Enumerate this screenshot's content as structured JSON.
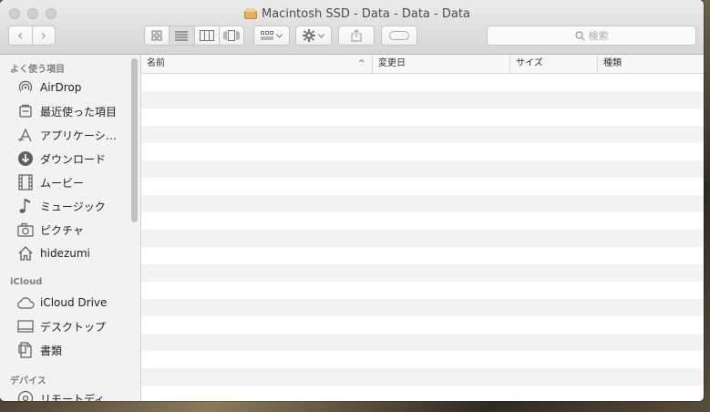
{
  "window": {
    "title": "Macintosh SSD - Data - Data - Data"
  },
  "toolbar": {
    "back": "‹",
    "forward": "›",
    "search_placeholder": "検索"
  },
  "sidebar": {
    "favorites_heading": "よく使う項目",
    "favorites": [
      {
        "label": "AirDrop",
        "icon": "airdrop-icon"
      },
      {
        "label": "最近使った項目",
        "icon": "recents-icon"
      },
      {
        "label": "アプリケーシ…",
        "icon": "applications-icon"
      },
      {
        "label": "ダウンロード",
        "icon": "downloads-icon"
      },
      {
        "label": "ムービー",
        "icon": "movies-icon"
      },
      {
        "label": "ミュージック",
        "icon": "music-icon"
      },
      {
        "label": "ピクチャ",
        "icon": "pictures-icon"
      },
      {
        "label": "hidezumi",
        "icon": "home-icon"
      }
    ],
    "icloud_heading": "iCloud",
    "icloud": [
      {
        "label": "iCloud Drive",
        "icon": "cloud-icon"
      },
      {
        "label": "デスクトップ",
        "icon": "desktop-icon"
      },
      {
        "label": "書類",
        "icon": "documents-icon"
      }
    ],
    "devices_heading": "デバイス",
    "devices": [
      {
        "label": "リモートディ…",
        "icon": "remote-disc-icon"
      }
    ]
  },
  "list": {
    "columns": [
      "名前",
      "変更日",
      "サイズ",
      "種類"
    ],
    "sort_indicator": "^"
  }
}
